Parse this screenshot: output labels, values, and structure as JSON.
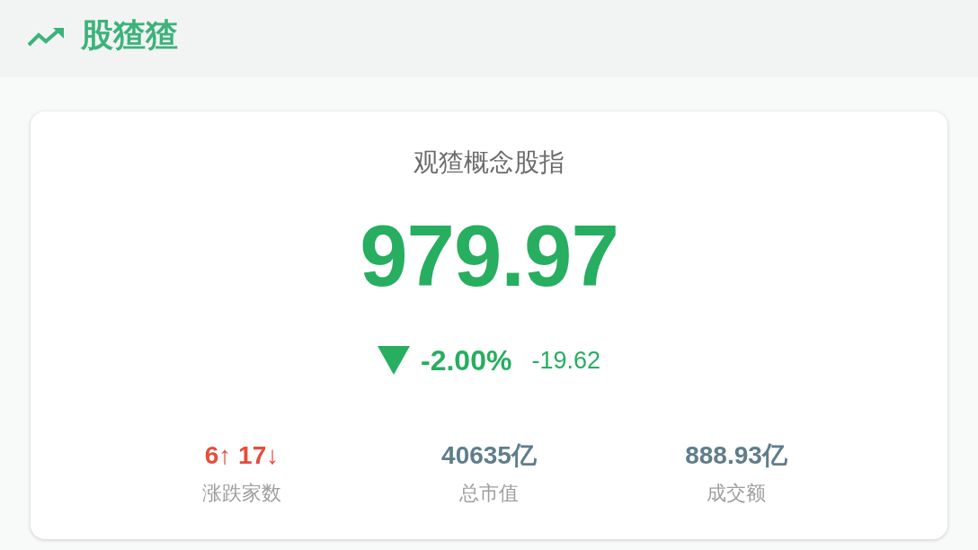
{
  "header": {
    "title": "股猹猹"
  },
  "index_card": {
    "title": "观猹概念股指",
    "value": "979.97",
    "change": {
      "falling": true,
      "percent": "-2.00%",
      "amount": "-19.62"
    },
    "stats": [
      {
        "kind": "breadth",
        "value": "6↑ 17↓",
        "label": "涨跌家数"
      },
      {
        "kind": "amount",
        "value": "40635亿",
        "label": "总市值"
      },
      {
        "kind": "amount",
        "value": "888.93亿",
        "label": "成交额"
      }
    ]
  }
}
